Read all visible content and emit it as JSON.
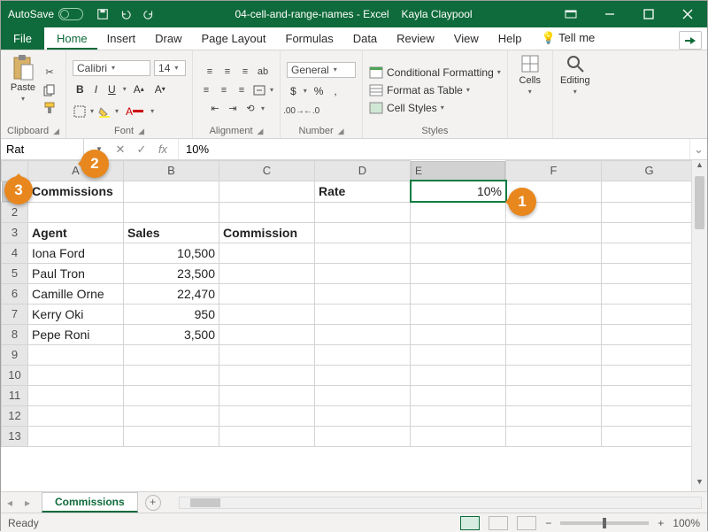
{
  "title": {
    "autosave": "AutoSave",
    "doc": "04-cell-and-range-names - Excel",
    "user": "Kayla Claypool"
  },
  "tabs": {
    "file": "File",
    "home": "Home",
    "insert": "Insert",
    "draw": "Draw",
    "pagelayout": "Page Layout",
    "formulas": "Formulas",
    "data": "Data",
    "review": "Review",
    "view": "View",
    "help": "Help",
    "tellme": "Tell me"
  },
  "ribbon": {
    "clipboard": {
      "paste": "Paste",
      "label": "Clipboard"
    },
    "font": {
      "name": "Calibri",
      "size": "14",
      "bold": "B",
      "italic": "I",
      "underline": "U",
      "label": "Font"
    },
    "alignment": {
      "label": "Alignment"
    },
    "number": {
      "format": "General",
      "label": "Number"
    },
    "styles": {
      "cond": "Conditional Formatting",
      "table": "Format as Table",
      "cell": "Cell Styles",
      "label": "Styles"
    },
    "cells": {
      "label": "Cells"
    },
    "editing": {
      "label": "Editing"
    }
  },
  "formulabar": {
    "namebox": "Rat",
    "value": "10%"
  },
  "columns": [
    "A",
    "B",
    "C",
    "D",
    "E",
    "F",
    "G"
  ],
  "rows": [
    "1",
    "2",
    "3",
    "4",
    "5",
    "6",
    "7",
    "8",
    "9",
    "10",
    "11",
    "12",
    "13"
  ],
  "cells": {
    "A1": "Commissions",
    "D1": "Rate",
    "E1": "10%",
    "A3": "Agent",
    "B3": "Sales",
    "C3": "Commission",
    "A4": "Iona Ford",
    "B4": "10,500",
    "A5": "Paul Tron",
    "B5": "23,500",
    "A6": "Camille Orne",
    "B6": "22,470",
    "A7": "Kerry Oki",
    "B7": "950",
    "A8": "Pepe Roni",
    "B8": "3,500"
  },
  "sheet": {
    "name": "Commissions"
  },
  "status": {
    "ready": "Ready",
    "zoom": "100%"
  },
  "markers": {
    "m1": "1",
    "m2": "2",
    "m3": "3"
  }
}
